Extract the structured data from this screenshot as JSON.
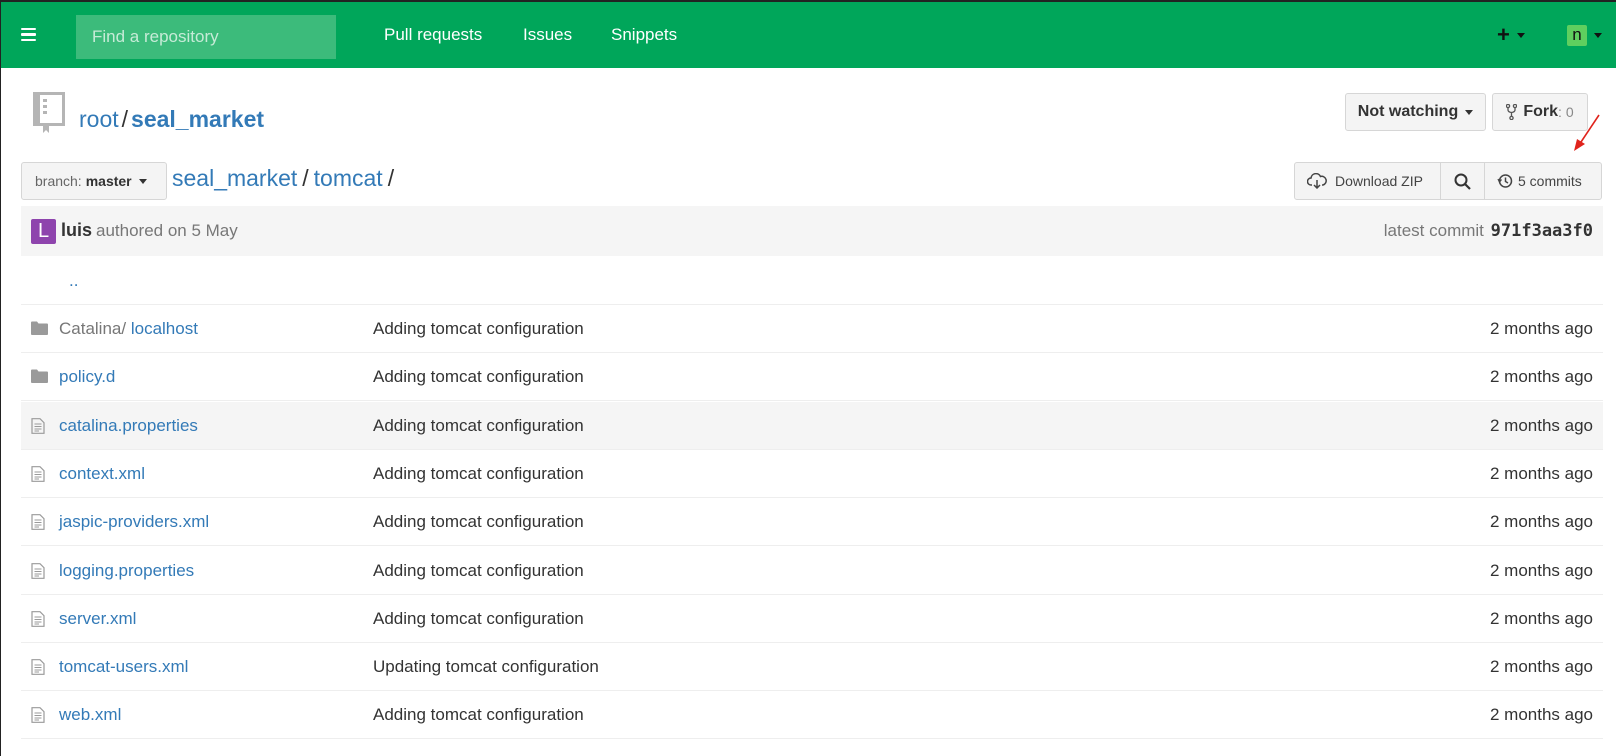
{
  "nav": {
    "search_placeholder": "Find a repository",
    "links": [
      "Pull requests",
      "Issues",
      "Snippets"
    ],
    "plus": "+",
    "user_initial": "n"
  },
  "repo": {
    "owner": "root",
    "separator": "/",
    "name": "seal_market",
    "watch_label": "Not watching",
    "fork_label": "Fork",
    "fork_count": ": 0"
  },
  "toolbar": {
    "branch_prefix": "branch:",
    "branch_name": "master",
    "breadcrumb": [
      "seal_market",
      "tomcat"
    ],
    "download_label": "Download ZIP",
    "commits_label": "5 commits"
  },
  "commit": {
    "avatar_initial": "L",
    "author": "luis",
    "authored_text": "authored on 5 May",
    "latest_label": "latest commit",
    "hash": "971f3aa3f0"
  },
  "files": {
    "parent_link": "..",
    "rows": [
      {
        "type": "folder",
        "prefix": "Catalina/",
        "name": "localhost",
        "message": "Adding tomcat configuration",
        "age": "2 months ago"
      },
      {
        "type": "folder",
        "prefix": "",
        "name": "policy.d",
        "message": "Adding tomcat configuration",
        "age": "2 months ago"
      },
      {
        "type": "file",
        "prefix": "",
        "name": "catalina.properties",
        "message": "Adding tomcat configuration",
        "age": "2 months ago"
      },
      {
        "type": "file",
        "prefix": "",
        "name": "context.xml",
        "message": "Adding tomcat configuration",
        "age": "2 months ago"
      },
      {
        "type": "file",
        "prefix": "",
        "name": "jaspic-providers.xml",
        "message": "Adding tomcat configuration",
        "age": "2 months ago"
      },
      {
        "type": "file",
        "prefix": "",
        "name": "logging.properties",
        "message": "Adding tomcat configuration",
        "age": "2 months ago"
      },
      {
        "type": "file",
        "prefix": "",
        "name": "server.xml",
        "message": "Adding tomcat configuration",
        "age": "2 months ago"
      },
      {
        "type": "file",
        "prefix": "",
        "name": "tomcat-users.xml",
        "message": "Updating tomcat configuration",
        "age": "2 months ago"
      },
      {
        "type": "file",
        "prefix": "",
        "name": "web.xml",
        "message": "Adding tomcat configuration",
        "age": "2 months ago"
      }
    ]
  },
  "colors": {
    "nav_green": "#00a65a",
    "link_blue": "#337ab7",
    "avatar_purple": "#8e44ad",
    "annotation_red": "#e0231c"
  }
}
